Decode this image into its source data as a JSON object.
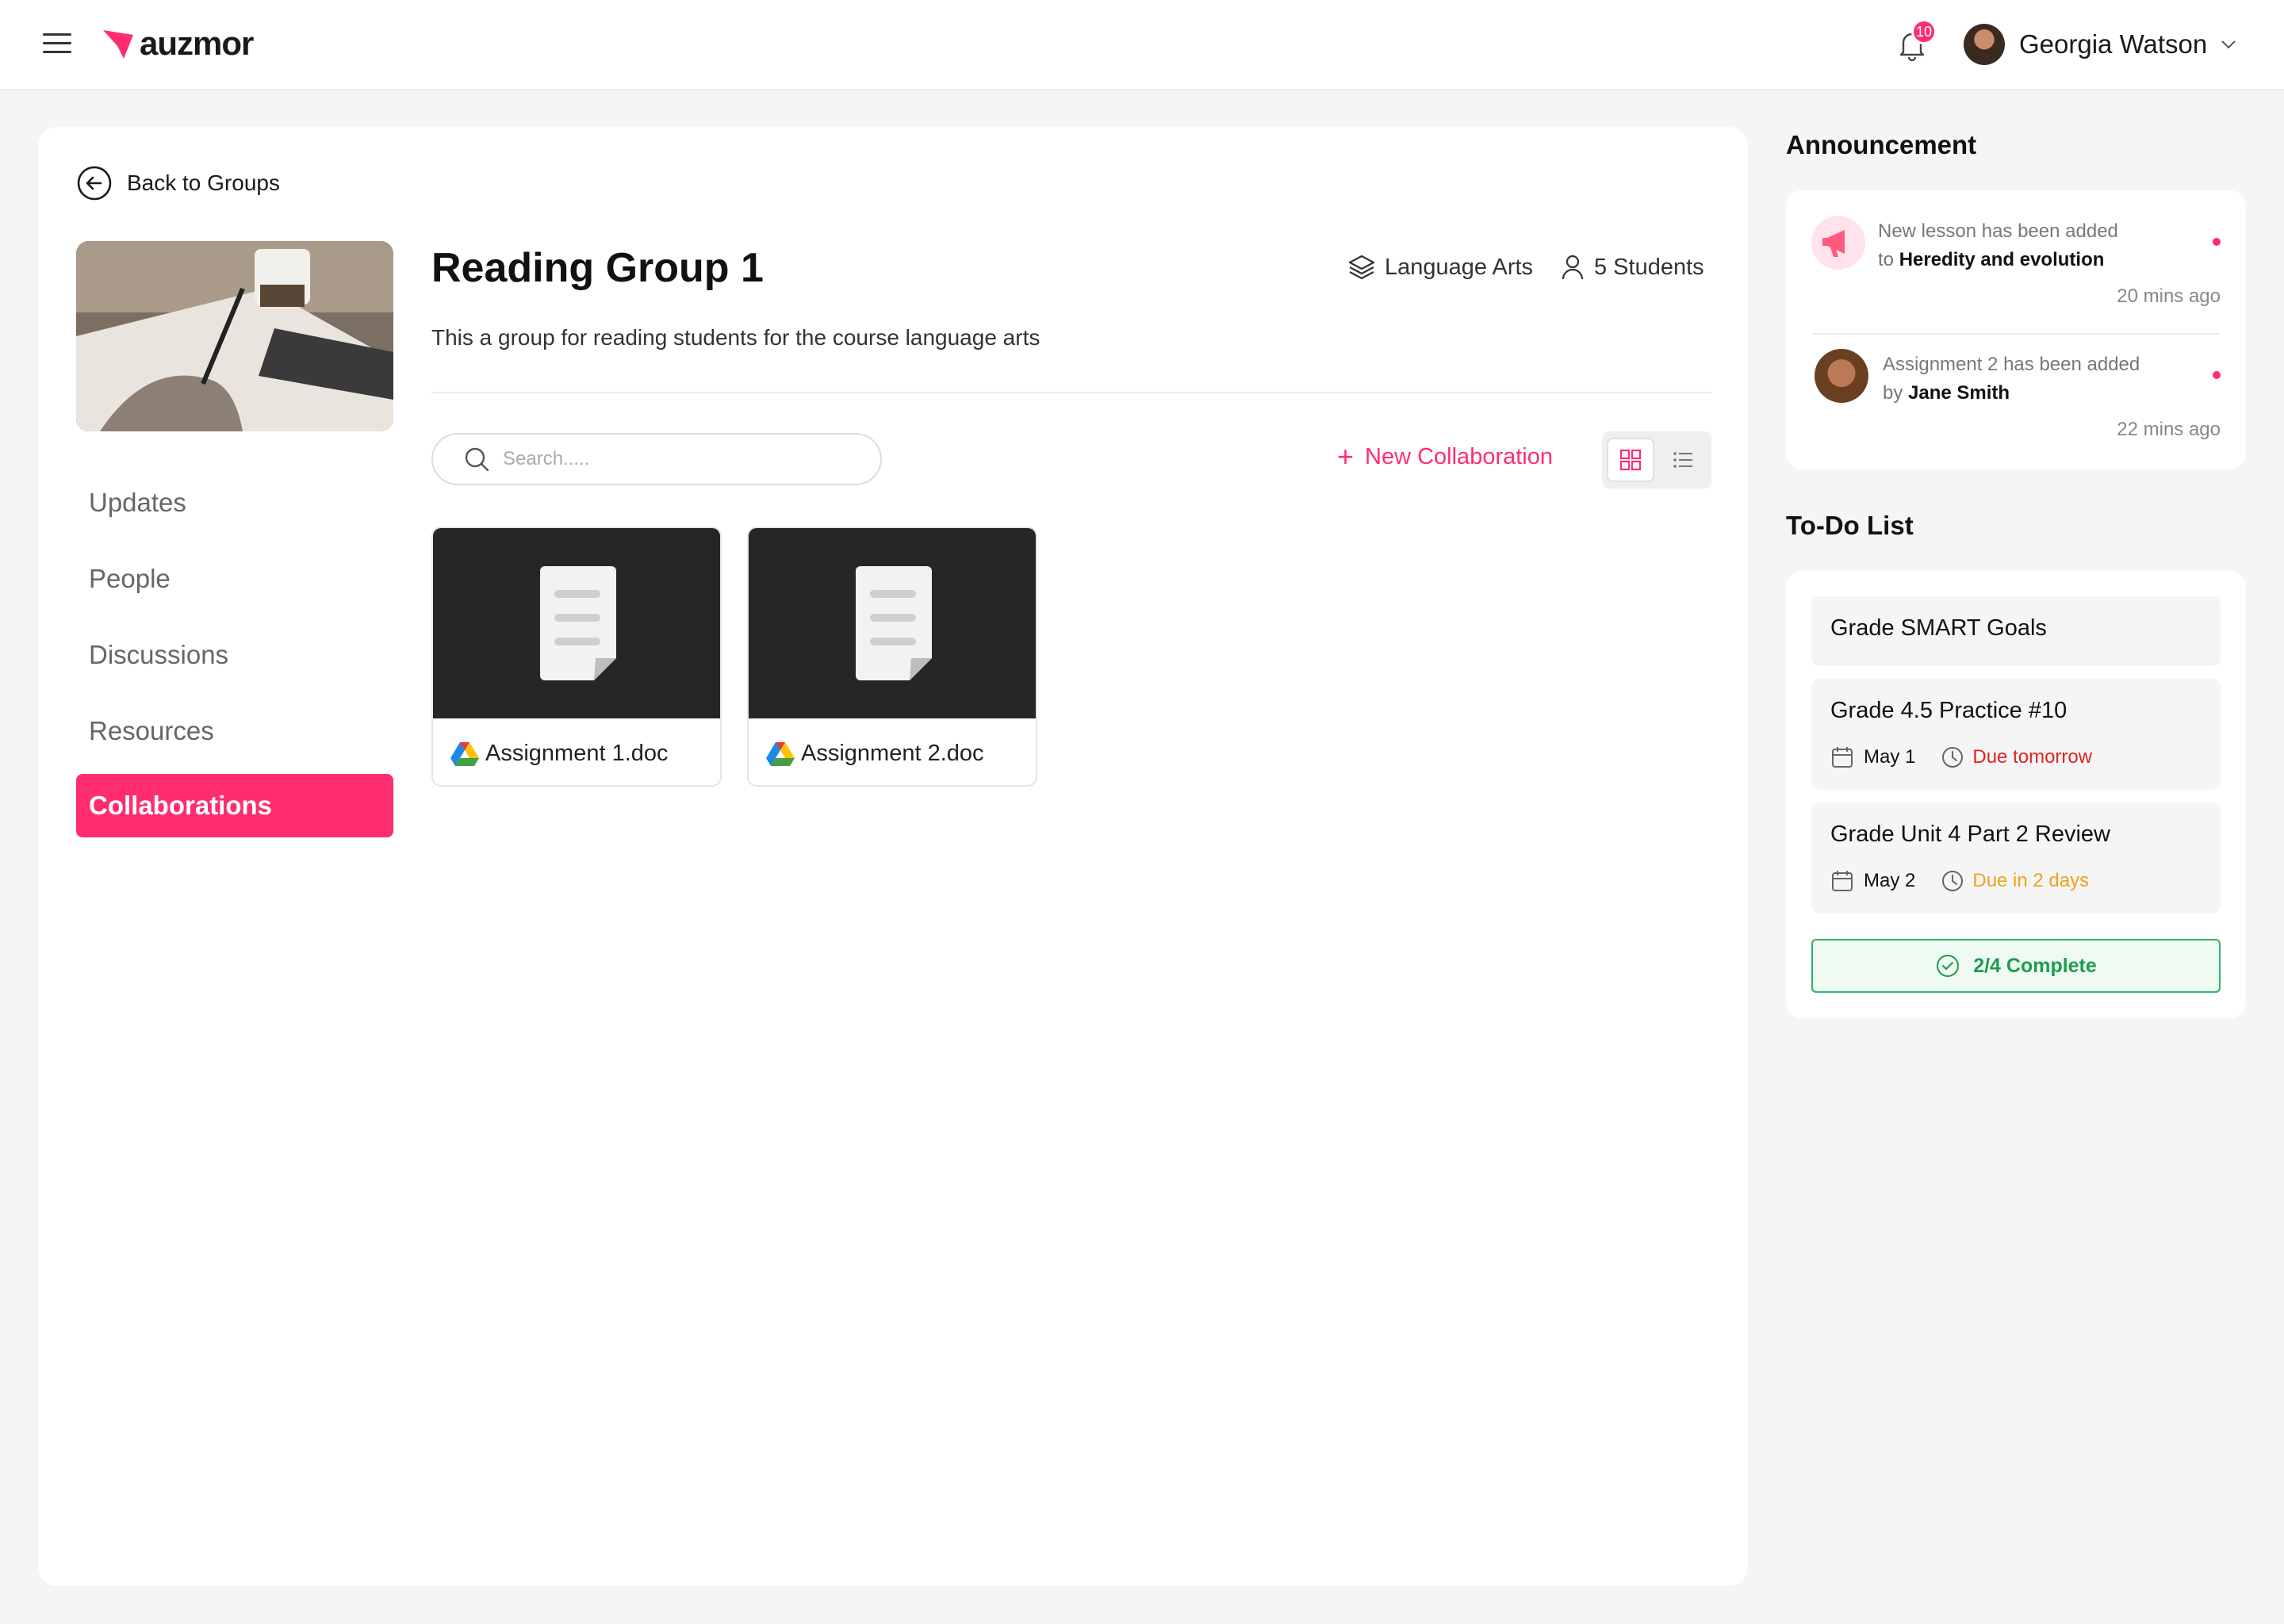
{
  "app": {
    "brand": "auzmor",
    "accent": "#ff2d6f"
  },
  "header": {
    "notification_count": "10",
    "user_name": "Georgia Watson"
  },
  "back_label": "Back to Groups",
  "nav": {
    "items": [
      {
        "label": "Updates"
      },
      {
        "label": "People"
      },
      {
        "label": "Discussions"
      },
      {
        "label": "Resources"
      },
      {
        "label": "Collaborations"
      }
    ],
    "active": "Collaborations"
  },
  "group": {
    "title": "Reading Group 1",
    "subject": "Language Arts",
    "students": "5 Students",
    "description": "This a group for reading students for the course language arts"
  },
  "toolbar": {
    "search_placeholder": "Search.....",
    "new_label": "New Collaboration"
  },
  "files": [
    {
      "name": "Assignment 1.doc"
    },
    {
      "name": "Assignment 2.doc"
    }
  ],
  "announcement": {
    "title": "Announcement",
    "items": [
      {
        "text": "New lesson has been added",
        "prefix": "to",
        "bold": "Heredity and evolution",
        "time": "20 mins ago"
      },
      {
        "text": "Assignment 2 has been added",
        "prefix": "by",
        "bold": "Jane Smith",
        "time": "22 mins ago"
      }
    ]
  },
  "todo": {
    "title": "To-Do List",
    "items": [
      {
        "title": "Grade SMART Goals"
      },
      {
        "title": "Grade 4.5 Practice #10",
        "date": "May 1",
        "due": "Due tomorrow",
        "due_color": "#e02424"
      },
      {
        "title": "Grade Unit 4 Part 2 Review",
        "date": "May 2",
        "due": "Due in 2 days",
        "due_color": "#f0a020"
      }
    ],
    "complete_label": "2/4 Complete"
  }
}
